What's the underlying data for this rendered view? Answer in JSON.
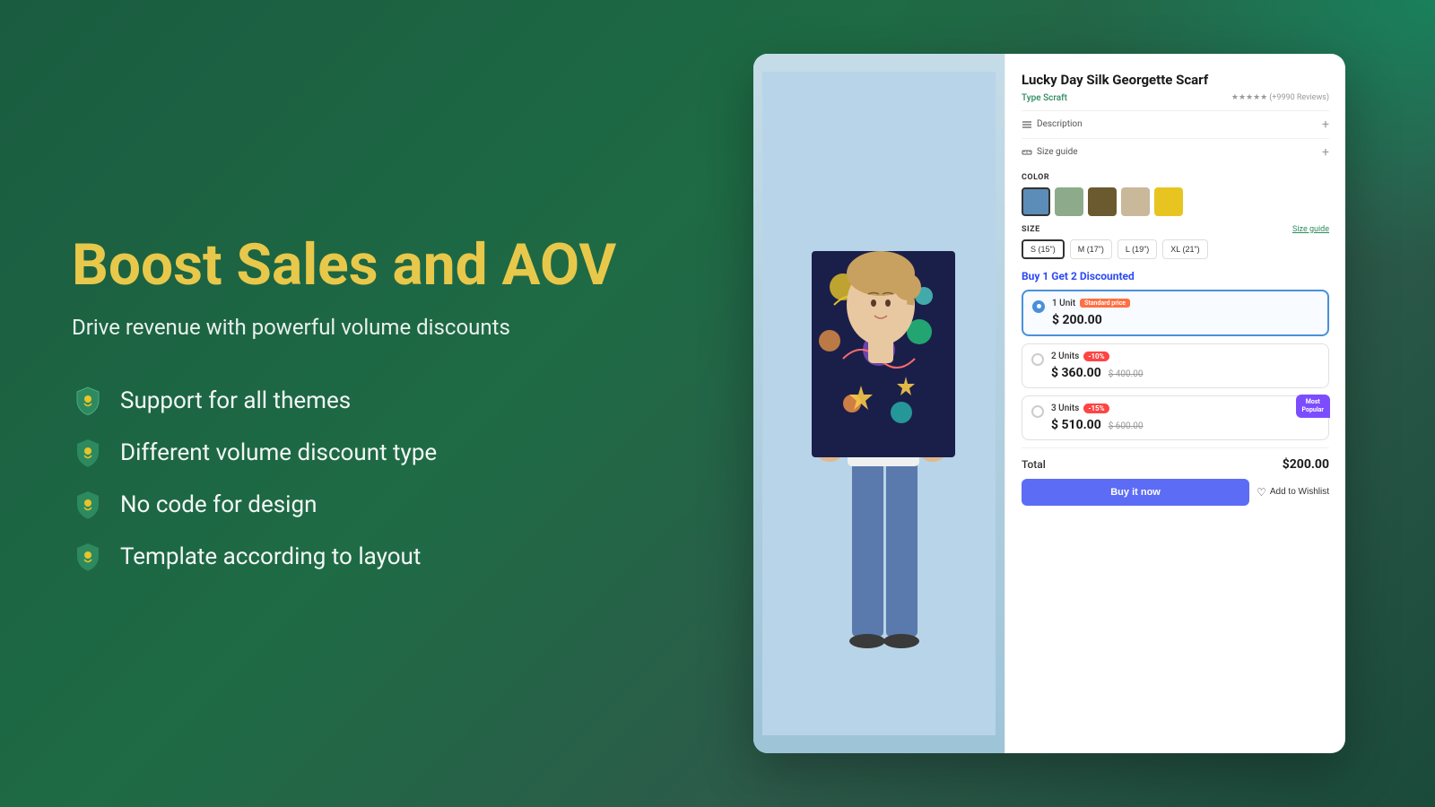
{
  "hero": {
    "title": "Boost Sales and AOV",
    "subtitle": "Drive revenue with powerful volume discounts",
    "features": [
      "Support for all themes",
      "Different volume discount type",
      "No code for design",
      "Template according to layout"
    ]
  },
  "product": {
    "title": "Lucky Day Silk Georgette Scarf",
    "type": "Type Scraft",
    "rating_stars": 5,
    "reviews": "(+9990 Reviews)",
    "sections": [
      {
        "label": "Description",
        "icon": "menu"
      },
      {
        "label": "Size guide",
        "icon": "ruler"
      }
    ],
    "color_label": "COLOR",
    "colors": [
      {
        "hex": "#5b8db8",
        "selected": true
      },
      {
        "hex": "#8dab8a",
        "selected": false
      },
      {
        "hex": "#6b5a2f",
        "selected": false
      },
      {
        "hex": "#c9b89a",
        "selected": false
      },
      {
        "hex": "#e8c420",
        "selected": false
      }
    ],
    "size_label": "SIZE",
    "size_guide_label": "Size guide",
    "sizes": [
      {
        "label": "S (15\")",
        "selected": true
      },
      {
        "label": "M (17\")",
        "selected": false
      },
      {
        "label": "L (19\")",
        "selected": false
      },
      {
        "label": "XL (21\")",
        "selected": false
      }
    ],
    "volume_title": "Buy 1 Get 2 Discounted",
    "volume_options": [
      {
        "units": "1 Unit",
        "badge": "Standard price",
        "badge_type": "standard",
        "price": "$ 200.00",
        "original": "",
        "selected": true,
        "most_popular": false
      },
      {
        "units": "2 Units",
        "badge": "-10%",
        "badge_type": "discount",
        "price": "$ 360.00",
        "original": "$ 400.00",
        "selected": false,
        "most_popular": false
      },
      {
        "units": "3 Units",
        "badge": "-15%",
        "badge_type": "discount",
        "price": "$ 510.00",
        "original": "$ 600.00",
        "selected": false,
        "most_popular": true,
        "most_popular_label": "Most\nPopular"
      }
    ],
    "total_label": "Total",
    "total_value": "$200.00",
    "buy_now_label": "Buy it now",
    "wishlist_label": "Add to Wishlist"
  }
}
